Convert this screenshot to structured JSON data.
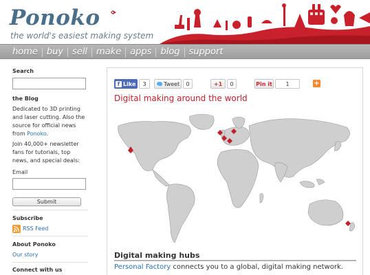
{
  "header": {
    "logo_text": "Ponoko",
    "tagline": "the world's easiest making system"
  },
  "nav": {
    "items": [
      "home",
      "buy",
      "sell",
      "make",
      "apps",
      "blog",
      "support"
    ]
  },
  "sidebar": {
    "search_heading": "Search",
    "blog_heading": "the Blog",
    "blog_text": "Dedicated to 3D printing and laser cutting. Also the source for official news from",
    "blog_link": "Ponoko",
    "blog_text_end": ".",
    "newsletter_text": "Join 40,000+ newsletter fans for tutorials, top news, and special deals:",
    "email_label": "Email",
    "submit_label": "Submit",
    "subscribe_heading": "Subscribe",
    "rss_label": "RSS Feed",
    "about_heading": "About Ponoko",
    "our_story": "Our story",
    "connect_heading": "Connect with us"
  },
  "social": {
    "facebook_label": "Like",
    "facebook_count": "3",
    "tweet_label": "Tweet",
    "tweet_count": "0",
    "gplus_label": "+1",
    "gplus_count": "0",
    "pinit_label": "Pin it",
    "pinit_count": "1",
    "add_label": "+"
  },
  "main": {
    "map_title": "Digital making around the world",
    "hubs_title": "Digital making hubs",
    "hubs_link": "Personal Factory",
    "hubs_text": " connects you to a global, digital making network."
  },
  "colors": {
    "brand_blue": "#4a6f8a",
    "accent_red": "#c1202b",
    "link_blue": "#2a6fb3",
    "nav_gray": "#a8a8a8"
  }
}
